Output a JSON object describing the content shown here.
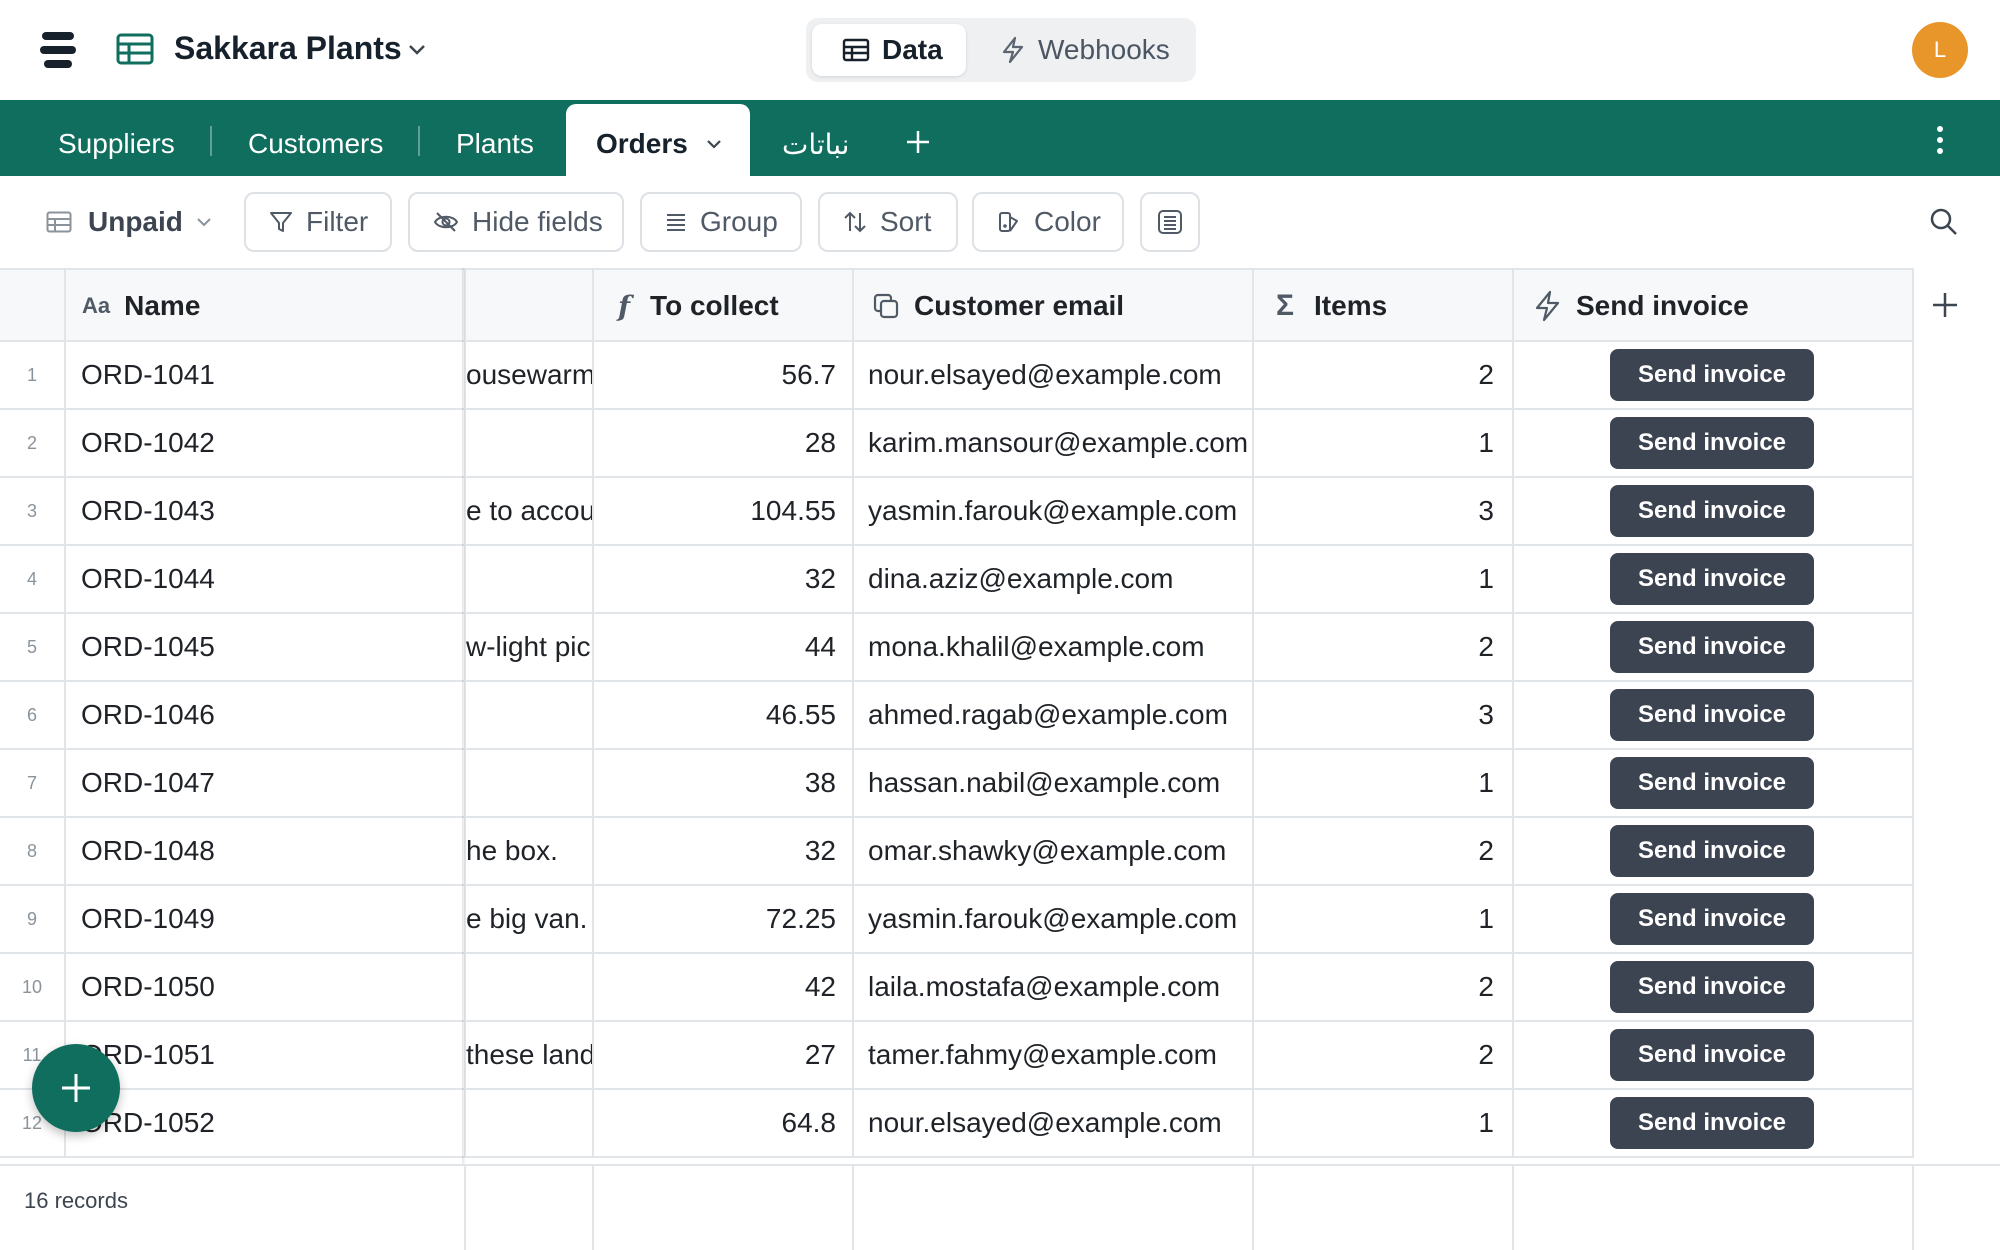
{
  "header": {
    "app_title": "Sakkara Plants",
    "segments": {
      "data_label": "Data",
      "webhooks_label": "Webhooks"
    },
    "avatar_initial": "L"
  },
  "tabs": [
    {
      "label": "Suppliers"
    },
    {
      "label": "Customers"
    },
    {
      "label": "Plants"
    },
    {
      "label": "Orders"
    },
    {
      "label": "نباتات"
    }
  ],
  "toolbar": {
    "view_name": "Unpaid",
    "filter_label": "Filter",
    "hide_fields_label": "Hide fields",
    "group_label": "Group",
    "sort_label": "Sort",
    "color_label": "Color"
  },
  "columns": {
    "name": "Name",
    "to_collect": "To collect",
    "customer_email": "Customer email",
    "items": "Items",
    "send_invoice": "Send invoice"
  },
  "rows": [
    {
      "num": "1",
      "name": "ORD-1041",
      "note": "ousewarm",
      "to_collect": "56.7",
      "email": "nour.elsayed@example.com",
      "items": "2",
      "button": "Send invoice"
    },
    {
      "num": "2",
      "name": "ORD-1042",
      "note": "",
      "to_collect": "28",
      "email": "karim.mansour@example.com",
      "items": "1",
      "button": "Send invoice"
    },
    {
      "num": "3",
      "name": "ORD-1043",
      "note": "e to accour",
      "to_collect": "104.55",
      "email": "yasmin.farouk@example.com",
      "items": "3",
      "button": "Send invoice"
    },
    {
      "num": "4",
      "name": "ORD-1044",
      "note": "",
      "to_collect": "32",
      "email": "dina.aziz@example.com",
      "items": "1",
      "button": "Send invoice"
    },
    {
      "num": "5",
      "name": "ORD-1045",
      "note": "w-light picl",
      "to_collect": "44",
      "email": "mona.khalil@example.com",
      "items": "2",
      "button": "Send invoice"
    },
    {
      "num": "6",
      "name": "ORD-1046",
      "note": "",
      "to_collect": "46.55",
      "email": "ahmed.ragab@example.com",
      "items": "3",
      "button": "Send invoice"
    },
    {
      "num": "7",
      "name": "ORD-1047",
      "note": "",
      "to_collect": "38",
      "email": "hassan.nabil@example.com",
      "items": "1",
      "button": "Send invoice"
    },
    {
      "num": "8",
      "name": "ORD-1048",
      "note": "he box.",
      "to_collect": "32",
      "email": "omar.shawky@example.com",
      "items": "2",
      "button": "Send invoice"
    },
    {
      "num": "9",
      "name": "ORD-1049",
      "note": "e big van.",
      "to_collect": "72.25",
      "email": "yasmin.farouk@example.com",
      "items": "1",
      "button": "Send invoice"
    },
    {
      "num": "10",
      "name": "ORD-1050",
      "note": "",
      "to_collect": "42",
      "email": "laila.mostafa@example.com",
      "items": "2",
      "button": "Send invoice"
    },
    {
      "num": "11",
      "name": "ORD-1051",
      "note": "these land",
      "to_collect": "27",
      "email": "tamer.fahmy@example.com",
      "items": "2",
      "button": "Send invoice"
    },
    {
      "num": "12",
      "name": "ORD-1052",
      "note": "",
      "to_collect": "64.8",
      "email": "nour.elsayed@example.com",
      "items": "1",
      "button": "Send invoice"
    }
  ],
  "footer": {
    "record_count": "16 records"
  },
  "colors": {
    "brand": "#0f6e5d",
    "avatar": "#e8962a",
    "button": "#3b4450"
  }
}
